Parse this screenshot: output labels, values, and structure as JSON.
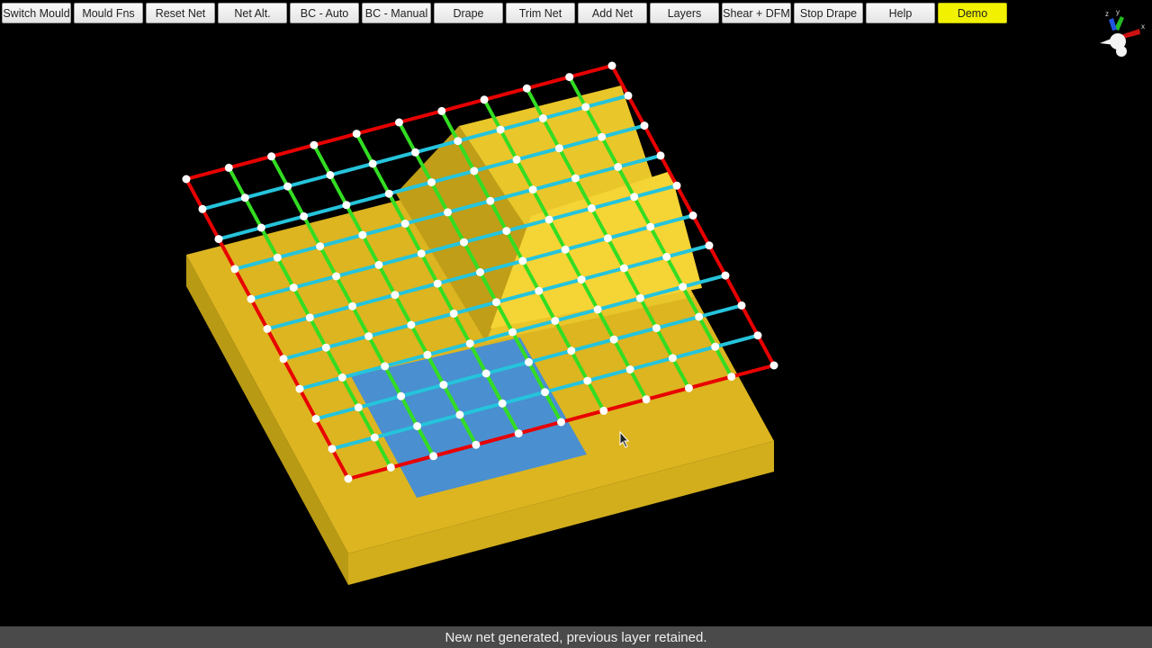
{
  "toolbar": {
    "buttons": [
      {
        "label": "Switch Mould",
        "active": false
      },
      {
        "label": "Mould Fns",
        "active": false
      },
      {
        "label": "Reset Net",
        "active": false
      },
      {
        "label": "Net Alt.",
        "active": false
      },
      {
        "label": "BC - Auto",
        "active": false
      },
      {
        "label": "BC - Manual",
        "active": false
      },
      {
        "label": "Drape",
        "active": false
      },
      {
        "label": "Trim Net",
        "active": false
      },
      {
        "label": "Add Net",
        "active": false
      },
      {
        "label": "Layers",
        "active": false
      },
      {
        "label": "Shear + DFM",
        "active": false
      },
      {
        "label": "Stop Drape",
        "active": false
      },
      {
        "label": "Help",
        "active": false
      },
      {
        "label": "Demo",
        "active": true
      }
    ]
  },
  "axis_gizmo": {
    "labels": [
      "z",
      "y",
      "x"
    ]
  },
  "status": {
    "message": "New net generated, previous layer retained."
  },
  "colors": {
    "mould_top": "#dcb520",
    "mould_side_left": "#b99a14",
    "mould_side_front": "#d2ae1c",
    "ramp_light": "#f5d435",
    "ramp_dark": "#c09e18",
    "previous_layer": "#4a8fd0",
    "net_boundary": "#e80000",
    "net_warp": "#33dd22",
    "net_weft": "#25c4dc",
    "net_node": "#ffffff",
    "demo_button": "#f2f200"
  },
  "net": {
    "rows": 11,
    "cols": 11
  }
}
